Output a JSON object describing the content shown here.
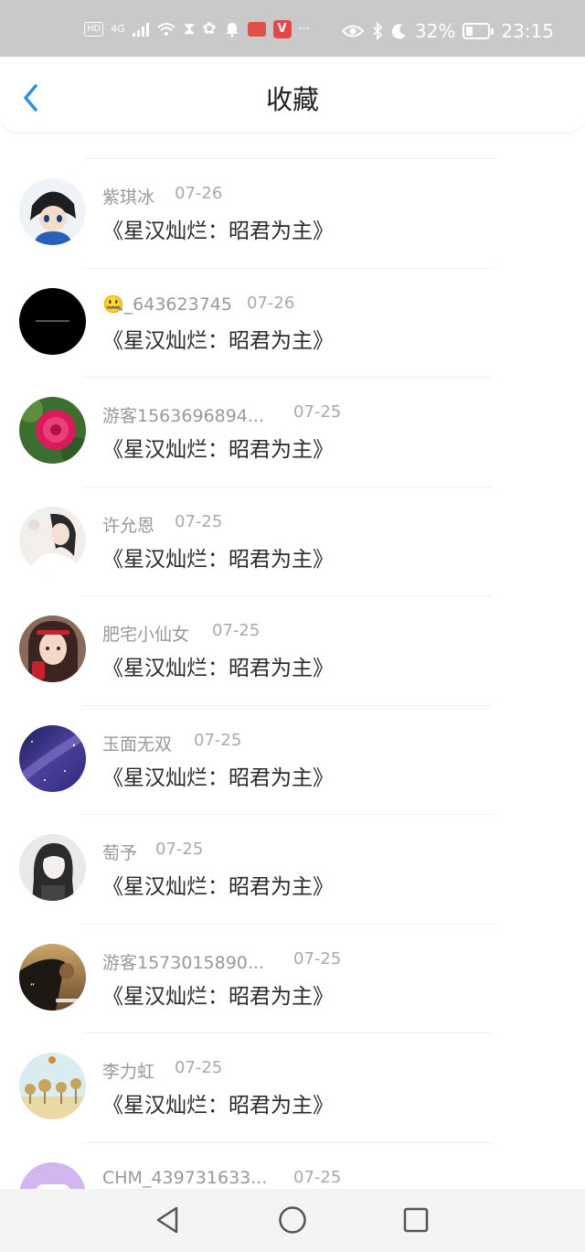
{
  "status_bar": {
    "hd": "HD",
    "network": "4G",
    "battery": "32%",
    "time": "23:15",
    "more": "···"
  },
  "header": {
    "title": "收藏"
  },
  "list": [
    {
      "name": "紫琪冰",
      "date": "07-26",
      "book": "《星汉灿烂：昭君为主》",
      "avatar": "anime-boy"
    },
    {
      "name": "🤐_643623745",
      "date": "07-26",
      "book": "《星汉灿烂：昭君为主》",
      "avatar": "black"
    },
    {
      "name": "游客1563696894...",
      "date": "07-25",
      "book": "《星汉灿烂：昭君为主》",
      "avatar": "peony"
    },
    {
      "name": "许允恩",
      "date": "07-25",
      "book": "《星汉灿烂：昭君为主》",
      "avatar": "girl-light"
    },
    {
      "name": "肥宅小仙女",
      "date": "07-25",
      "book": "《星汉灿烂：昭君为主》",
      "avatar": "girl-red"
    },
    {
      "name": "玉面无双",
      "date": "07-25",
      "book": "《星汉灿烂：昭君为主》",
      "avatar": "galaxy"
    },
    {
      "name": "萄予",
      "date": "07-25",
      "book": "《星汉灿烂：昭君为主》",
      "avatar": "anime-girl"
    },
    {
      "name": "游客1573015890...",
      "date": "07-25",
      "book": "《星汉灿烂：昭君为主》",
      "avatar": "sunset-girl"
    },
    {
      "name": "李力虹",
      "date": "07-25",
      "book": "《星汉灿烂：昭君为主》",
      "avatar": "trees"
    },
    {
      "name": "CHM_439731633...",
      "date": "07-25",
      "book": "",
      "avatar": "purple"
    }
  ],
  "colors": {
    "status_bar_bg": "#c9c9c9",
    "accent_blue": "#2f8fe6",
    "name_gray": "#999999",
    "title_text": "#2a2a2a"
  },
  "icons": {
    "back": "chevron-left-icon",
    "nav_back": "triangle-back-icon",
    "nav_home": "circle-home-icon",
    "nav_recent": "square-recent-icon"
  }
}
